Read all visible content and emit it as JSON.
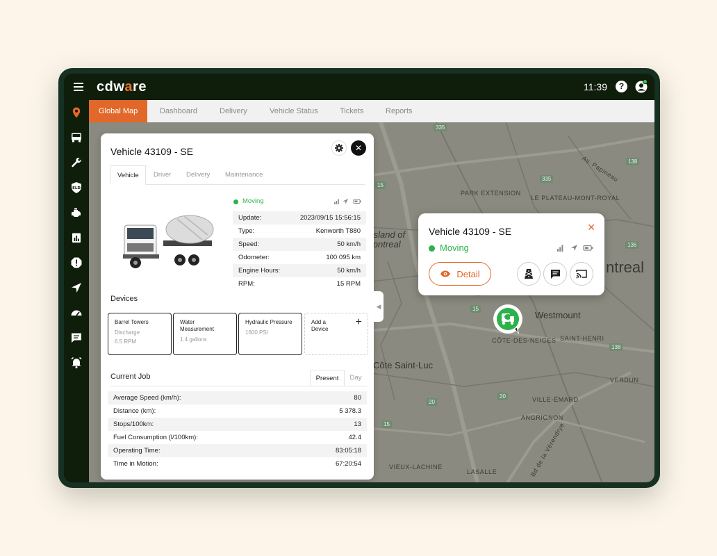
{
  "app": {
    "logo_text": "cdw",
    "logo_accent": "a",
    "logo_rest": "re",
    "time": "11:39",
    "help_label": "?"
  },
  "nav": {
    "icons": [
      "location-icon",
      "truck-icon",
      "wrench-icon",
      "eld-icon",
      "engine-icon",
      "report-icon",
      "alert-icon",
      "navigation-icon",
      "dashboard-gauge-icon",
      "message-icon",
      "alarm-icon"
    ],
    "eld_text": "ELD"
  },
  "tabs": [
    "Global Map",
    "Dashboard",
    "Delivery",
    "Vehicle Status",
    "Tickets",
    "Reports"
  ],
  "map": {
    "labels": [
      "PARK EXTENSION",
      "LE PLATEAU-MONT-ROYAL",
      "Island of",
      "Montreal",
      "ntreal",
      "Westmount",
      "CÔTE-DES-NEIGES",
      "SAINT-HENRI",
      "Côte Saint-Luc",
      "VERDUN",
      "VILLE-ÉMARD",
      "ANGRIGNON",
      "LASALLE",
      "VIEUX-LACHINE",
      "Av. Papineau",
      "Bd de la Vérendrye"
    ],
    "shields": [
      "335",
      "335",
      "15",
      "138",
      "138",
      "335",
      "136",
      "15",
      "15",
      "20",
      "20",
      "138",
      "138"
    ]
  },
  "panel": {
    "title": "Vehicle 43109 - SE",
    "close_label": "✕",
    "subtabs": [
      "Vehicle",
      "Driver",
      "Delivery",
      "Maintenance"
    ],
    "status": "Moving",
    "details": [
      {
        "k": "Update:",
        "v": "2023/09/15 15:56:15"
      },
      {
        "k": "Type:",
        "v": "Kenworth T880"
      },
      {
        "k": "Speed:",
        "v": "50 km/h"
      },
      {
        "k": "Odometer:",
        "v": "100 095 km"
      },
      {
        "k": "Engine Hours:",
        "v": "50 km/h"
      },
      {
        "k": "RPM:",
        "v": "15 RPM"
      }
    ],
    "devices_title": "Devices",
    "devices": [
      {
        "name": "Barrel Towers",
        "sub": "Discharge",
        "val": "6.5 RPM"
      },
      {
        "name": "Water Measurement",
        "sub": "",
        "val": "1.4 gallons"
      },
      {
        "name": "Hydraulic Pressure",
        "sub": "",
        "val": "1600 PSI"
      }
    ],
    "add_device": "Add a Device",
    "add_plus": "+",
    "job_title": "Current Job",
    "job_tabs": [
      "Present",
      "Day"
    ],
    "job": [
      {
        "k": "Average Speed (km/h):",
        "v": "80"
      },
      {
        "k": "Distance (km):",
        "v": "5 378.3"
      },
      {
        "k": "Stops/100km:",
        "v": "13"
      },
      {
        "k": "Fuel Consumption (l/100km):",
        "v": "42.4"
      },
      {
        "k": "Operating Time:",
        "v": "83:05:18"
      },
      {
        "k": "Time in Motion:",
        "v": "67:20:54"
      }
    ]
  },
  "popup": {
    "title": "Vehicle 43109 - SE",
    "close_label": "✕",
    "status": "Moving",
    "detail_label": "Detail"
  },
  "colors": {
    "accent": "#e2682a",
    "moving": "#2db14a",
    "chrome": "#0f1d0b",
    "map": "#8b8a80"
  }
}
